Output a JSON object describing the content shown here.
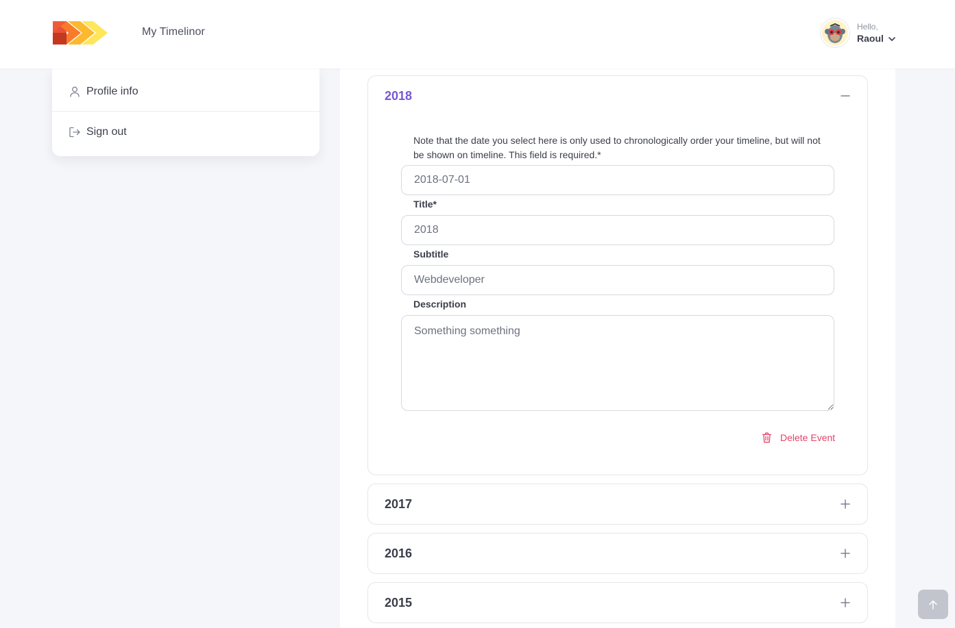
{
  "header": {
    "app_title": "My Timelinor",
    "greeting": "Hello,",
    "user_name": "Raoul"
  },
  "sidebar": {
    "items": [
      {
        "label": "Profile info",
        "icon": "user-icon"
      },
      {
        "label": "Sign out",
        "icon": "sign-out-icon"
      }
    ]
  },
  "events": {
    "open": {
      "year": "2018",
      "note": "Note that the date you select here is only used to chronologically order your timeline, but will not be shown on timeline. This field is required.*",
      "date_value": "2018-07-01",
      "title_label": "Title*",
      "title_value": "2018",
      "subtitle_label": "Subtitle",
      "subtitle_value": "Webdeveloper",
      "description_label": "Description",
      "description_value": "Something something",
      "delete_label": "Delete Event"
    },
    "collapsed": [
      {
        "year": "2017"
      },
      {
        "year": "2016"
      },
      {
        "year": "2015"
      }
    ]
  },
  "colors": {
    "accent": "#7857d6",
    "danger": "#e2436b"
  }
}
